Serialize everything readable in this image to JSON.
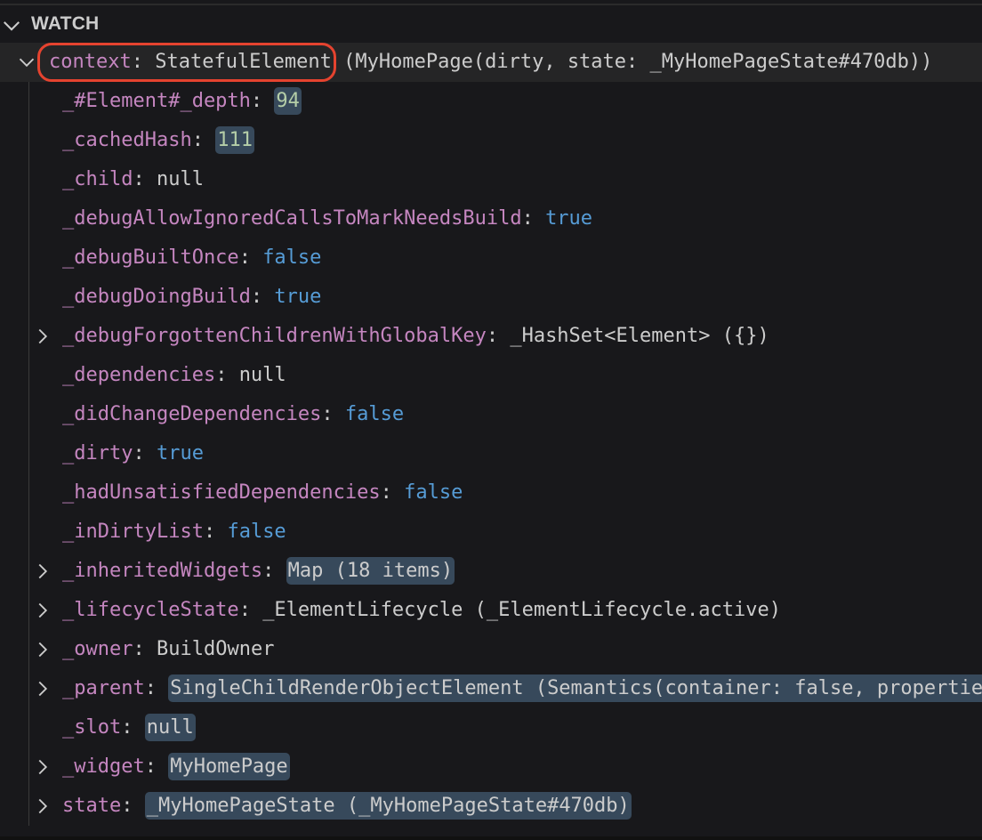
{
  "panel": {
    "title": "WATCH"
  },
  "root": {
    "name": "context",
    "sep": ":",
    "type": "StatefulElement",
    "rest": "(MyHomePage(dirty, state: _MyHomePageState#470db))"
  },
  "rows": [
    {
      "name": "_#Element#_depth",
      "sep": ":",
      "value": "94"
    },
    {
      "name": "_cachedHash",
      "sep": ":",
      "value": "111"
    },
    {
      "name": "_child",
      "sep": ":",
      "value": "null"
    },
    {
      "name": "_debugAllowIgnoredCallsToMarkNeedsBuild",
      "sep": ":",
      "value": "true"
    },
    {
      "name": "_debugBuiltOnce",
      "sep": ":",
      "value": "false"
    },
    {
      "name": "_debugDoingBuild",
      "sep": ":",
      "value": "true"
    },
    {
      "name": "_debugForgottenChildrenWithGlobalKey",
      "sep": ":",
      "value": "_HashSet<Element> ({})"
    },
    {
      "name": "_dependencies",
      "sep": ":",
      "value": "null"
    },
    {
      "name": "_didChangeDependencies",
      "sep": ":",
      "value": "false"
    },
    {
      "name": "_dirty",
      "sep": ":",
      "value": "true"
    },
    {
      "name": "_hadUnsatisfiedDependencies",
      "sep": ":",
      "value": "false"
    },
    {
      "name": "_inDirtyList",
      "sep": ":",
      "value": "false"
    },
    {
      "name": "_inheritedWidgets",
      "sep": ":",
      "value": "Map (18 items)"
    },
    {
      "name": "_lifecycleState",
      "sep": ":",
      "value": "_ElementLifecycle (_ElementLifecycle.active)"
    },
    {
      "name": "_owner",
      "sep": ":",
      "value": "BuildOwner"
    },
    {
      "name": "_parent",
      "sep": ":",
      "value": "SingleChildRenderObjectElement (Semantics(container: false, properties"
    },
    {
      "name": "_slot",
      "sep": ":",
      "value": "null"
    },
    {
      "name": "_widget",
      "sep": ":",
      "value": "MyHomePage"
    },
    {
      "name": "state",
      "sep": ":",
      "value": "_MyHomePageState (_MyHomePageState#470db)"
    }
  ],
  "colors": {
    "background": "#18181b",
    "property": "#c586c0",
    "number": "#b5cea8",
    "boolean": "#569cd6",
    "highlight": "#37495b",
    "callout": "#e5432f"
  }
}
